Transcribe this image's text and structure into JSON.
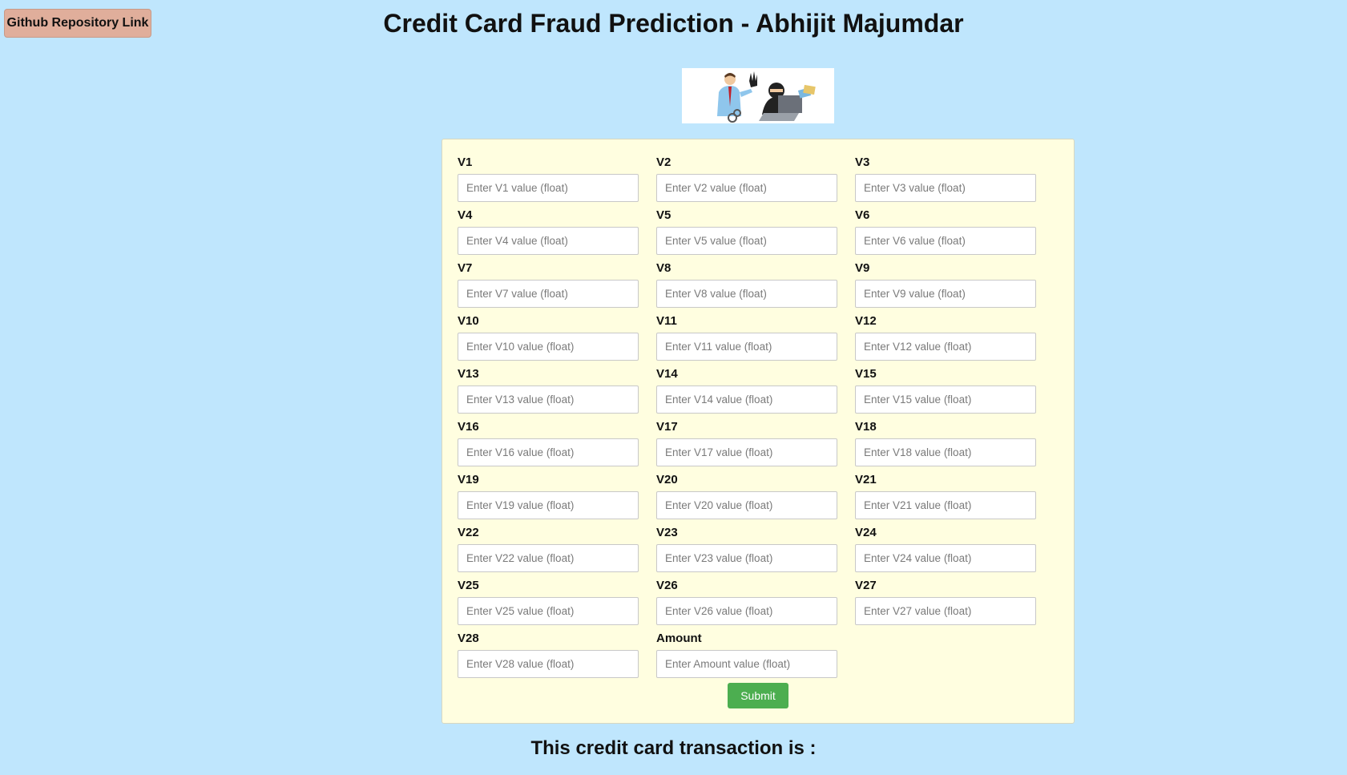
{
  "header": {
    "github_link": "Github Repository Link",
    "title": "Credit Card Fraud Prediction - Abhijit Majumdar"
  },
  "form": {
    "fields": [
      {
        "label": "V1",
        "placeholder": "Enter V1 value (float)"
      },
      {
        "label": "V2",
        "placeholder": "Enter V2 value (float)"
      },
      {
        "label": "V3",
        "placeholder": "Enter V3 value (float)"
      },
      {
        "label": "V4",
        "placeholder": "Enter V4 value (float)"
      },
      {
        "label": "V5",
        "placeholder": "Enter V5 value (float)"
      },
      {
        "label": "V6",
        "placeholder": "Enter V6 value (float)"
      },
      {
        "label": "V7",
        "placeholder": "Enter V7 value (float)"
      },
      {
        "label": "V8",
        "placeholder": "Enter V8 value (float)"
      },
      {
        "label": "V9",
        "placeholder": "Enter V9 value (float)"
      },
      {
        "label": "V10",
        "placeholder": "Enter V10 value (float)"
      },
      {
        "label": "V11",
        "placeholder": "Enter V11 value (float)"
      },
      {
        "label": "V12",
        "placeholder": "Enter V12 value (float)"
      },
      {
        "label": "V13",
        "placeholder": "Enter V13 value (float)"
      },
      {
        "label": "V14",
        "placeholder": "Enter V14 value (float)"
      },
      {
        "label": "V15",
        "placeholder": "Enter V15 value (float)"
      },
      {
        "label": "V16",
        "placeholder": "Enter V16 value (float)"
      },
      {
        "label": "V17",
        "placeholder": "Enter V17 value (float)"
      },
      {
        "label": "V18",
        "placeholder": "Enter V18 value (float)"
      },
      {
        "label": "V19",
        "placeholder": "Enter V19 value (float)"
      },
      {
        "label": "V20",
        "placeholder": "Enter V20 value (float)"
      },
      {
        "label": "V21",
        "placeholder": "Enter V21 value (float)"
      },
      {
        "label": "V22",
        "placeholder": "Enter V22 value (float)"
      },
      {
        "label": "V23",
        "placeholder": "Enter V23 value (float)"
      },
      {
        "label": "V24",
        "placeholder": "Enter V24 value (float)"
      },
      {
        "label": "V25",
        "placeholder": "Enter V25 value (float)"
      },
      {
        "label": "V26",
        "placeholder": "Enter V26 value (float)"
      },
      {
        "label": "V27",
        "placeholder": "Enter V27 value (float)"
      },
      {
        "label": "V28",
        "placeholder": "Enter V28 value (float)"
      },
      {
        "label": "Amount",
        "placeholder": "Enter Amount value (float)"
      }
    ],
    "submit_label": "Submit"
  },
  "result": {
    "text": "This credit card transaction is :"
  },
  "colors": {
    "page_background": "#bfe6fd",
    "form_background": "#fffee0",
    "github_button": "#e0ae9b",
    "submit_button": "#4cae50"
  },
  "icons": {
    "hero": "fraud-illustration-icon"
  }
}
